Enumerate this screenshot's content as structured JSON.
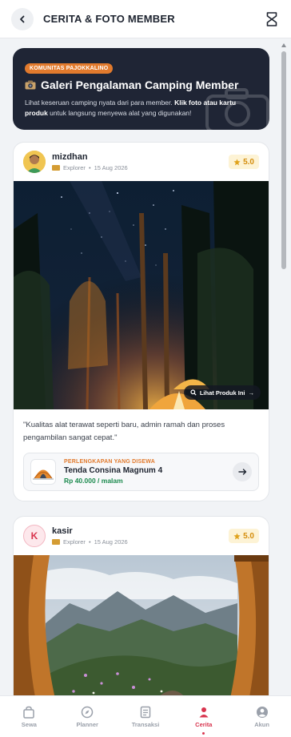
{
  "header": {
    "title": "CERITA & FOTO MEMBER"
  },
  "hero": {
    "badge": "KOMUNITAS PAJOKKALINO",
    "title": "Galeri Pengalaman Camping Member",
    "desc_prefix": "Lihat keseruan camping nyata dari para member. ",
    "desc_bold1": "Klik foto atau kartu produk",
    "desc_suffix": " untuk langsung menyewa alat yang digunakan!"
  },
  "posts": [
    {
      "username": "mizdhan",
      "rank": "Explorer",
      "date": "15 Aug 2026",
      "rating": "5.0",
      "lihat_label": "Lihat Produk Ini",
      "review": "\"Kualitas alat terawat seperti baru, admin ramah dan proses pengambilan sangat cepat.\"",
      "product": {
        "label": "PERLENGKAPAN YANG DISEWA",
        "name": "Tenda Consina Magnum 4",
        "price": "Rp 40.000 / malam"
      }
    },
    {
      "username": "kasir",
      "avatar_initial": "K",
      "rank": "Explorer",
      "date": "15 Aug 2026",
      "rating": "5.0"
    }
  ],
  "nav": {
    "items": [
      {
        "label": "Sewa",
        "icon": "bag-icon"
      },
      {
        "label": "Planner",
        "icon": "compass-icon"
      },
      {
        "label": "Transaksi",
        "icon": "document-icon"
      },
      {
        "label": "Cerita",
        "icon": "user-icon"
      },
      {
        "label": "Akun",
        "icon": "account-icon"
      }
    ],
    "active": "Cerita"
  },
  "colors": {
    "accent": "#d8344e",
    "orange": "#e17a2d",
    "price_green": "#1c8a4e",
    "hero_bg": "#1f2535",
    "rating": "#d48d0d"
  }
}
